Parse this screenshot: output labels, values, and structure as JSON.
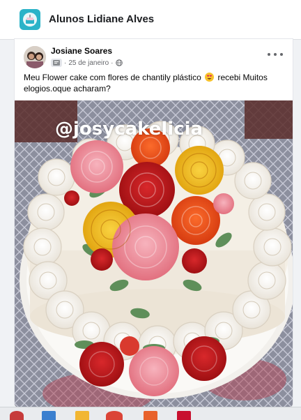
{
  "group": {
    "name": "Alunos Lidiane Alves",
    "icon": "cake-group-icon"
  },
  "post": {
    "author": "Josiane Soares",
    "date": "25 de janeiro",
    "separator": "·",
    "audience_icon": "globe-icon",
    "text_before_emoji": "Meu Flower cake com flores de chantily plástico",
    "emoji": "heart-eyes-emoji",
    "text_after_emoji": "recebi Muitos elogios.oque acharam?",
    "photo": {
      "description_icon": "flower-cake-photo",
      "watermark": "@josycakelicia"
    }
  },
  "colors": {
    "accent": "#2bb3c8",
    "page_bg": "#f0f2f5",
    "text": "#050505",
    "muted": "#65676b"
  },
  "taskbar": {
    "icons": [
      "paint-icon",
      "calculator-icon",
      "folder-icon",
      "chrome-icon",
      "app-icon",
      "pdf-icon"
    ]
  }
}
